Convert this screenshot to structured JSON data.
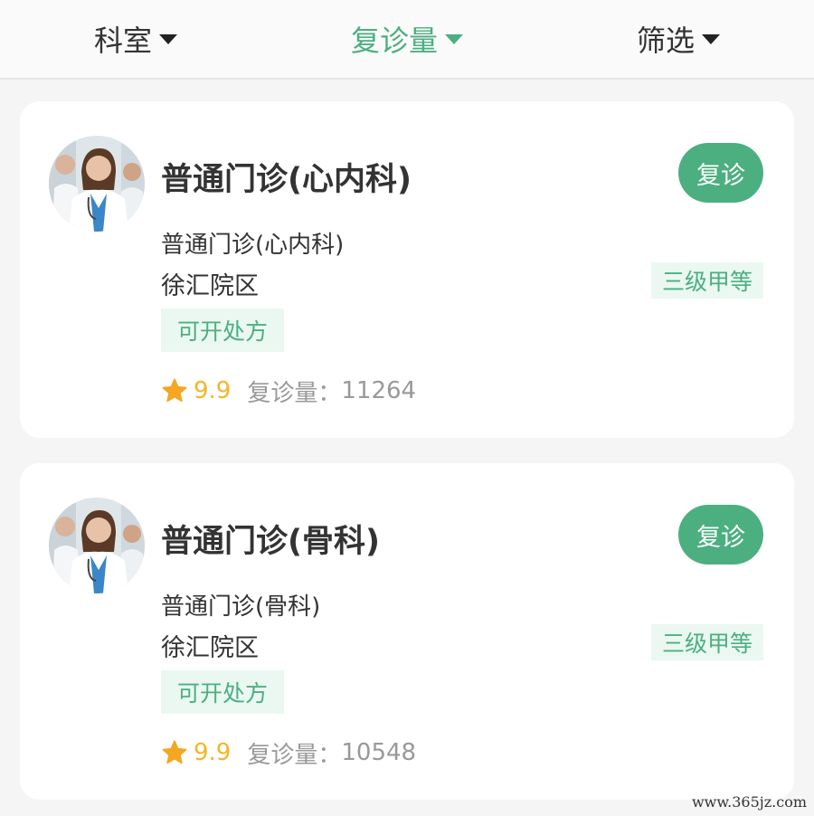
{
  "filters": [
    {
      "label": "科室",
      "active": false
    },
    {
      "label": "复诊量",
      "active": true
    },
    {
      "label": "筛选",
      "active": false
    }
  ],
  "colors": {
    "accent": "#4caf80",
    "star": "#f5b623",
    "badge_bg": "#eaf8f1"
  },
  "cards": [
    {
      "title": "普通门诊(心内科)",
      "action_label": "复诊",
      "subtitle": "普通门诊(心内科)",
      "campus": "徐汇院区",
      "grade": "三级甲等",
      "tag": "可开处方",
      "rating": "9.9",
      "count_label": "复诊量：",
      "count": "11264"
    },
    {
      "title": "普通门诊(骨科)",
      "action_label": "复诊",
      "subtitle": "普通门诊(骨科)",
      "campus": "徐汇院区",
      "grade": "三级甲等",
      "tag": "可开处方",
      "rating": "9.9",
      "count_label": "复诊量：",
      "count": "10548"
    }
  ],
  "watermark": "www.365jz.com"
}
